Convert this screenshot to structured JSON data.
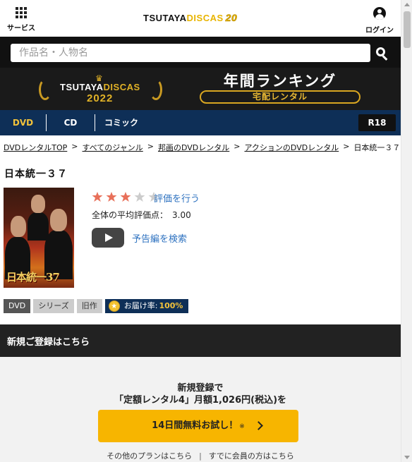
{
  "header": {
    "service_label": "サービス",
    "login_label": "ログイン",
    "logo_text_a": "TSUTAYA",
    "logo_text_b": "DISCAS",
    "logo_anniv": "20"
  },
  "search": {
    "placeholder": "作品名・人物名"
  },
  "banner": {
    "brand_a": "TSUTAYA",
    "brand_b": "DISCAS",
    "year": "2022",
    "title": "年間ランキング",
    "subtitle": "宅配レンタル"
  },
  "categories": {
    "dvd": "DVD",
    "cd": "CD",
    "comic": "コミック",
    "r18": "R18"
  },
  "breadcrumb": {
    "items": [
      "DVDレンタルTOP",
      "すべてのジャンル",
      "邦画のDVDレンタル",
      "アクションのDVDレンタル"
    ],
    "current": "日本統一３７",
    "separator": ">"
  },
  "product": {
    "title": "日本統一３７",
    "poster_text": "日本統一37",
    "rating_stars": 3,
    "rating_max": 5,
    "rate_link": "評価を行う",
    "avg_label": "全体の平均評価点：",
    "avg_value": "3.00",
    "trailer_link": "予告編を検索",
    "tags": [
      "DVD",
      "シリーズ",
      "旧作"
    ],
    "delivery_label": "お届け率:",
    "delivery_rate": "100%"
  },
  "register": {
    "header": "新規ご登録はこちら",
    "line1": "新規登録で",
    "line2": "「定額レンタル4」月額1,026円(税込)を",
    "cta": "14日間無料お試し！",
    "cta_note": "※",
    "link_plans": "その他のプランはこちら",
    "link_members": "すでに会員の方はこちら"
  },
  "colors": {
    "accent_gold": "#f7b500",
    "nav_navy": "#0e2f57",
    "link_blue": "#2e72c0",
    "star_on": "#e8705a",
    "star_off": "#cccccc"
  }
}
